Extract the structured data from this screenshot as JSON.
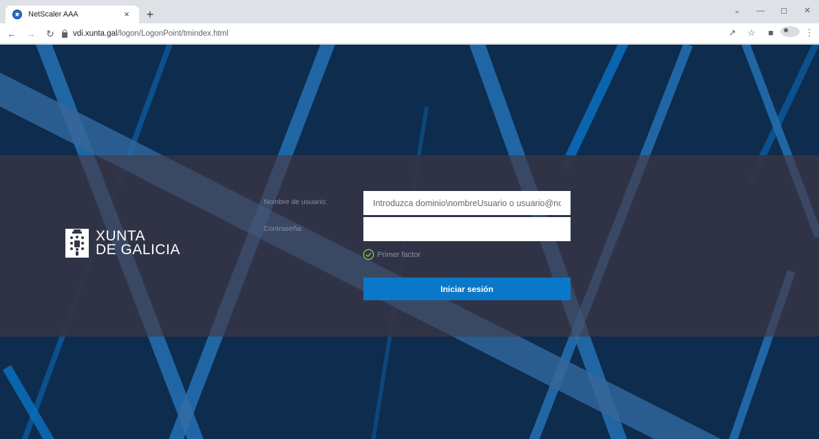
{
  "browser": {
    "tab_title": "NetScaler AAA",
    "tab_close": "×",
    "new_tab": "+",
    "url_host": "vdi.xunta.gal",
    "url_path": "/logon/LogonPoint/tmindex.html",
    "icons": [
      "back-icon",
      "forward-icon",
      "reload-icon",
      "lock-icon",
      "share-icon",
      "star-icon",
      "side-panel-icon",
      "profile-icon",
      "menu-icon"
    ]
  },
  "logo": {
    "line1": "XUNTA",
    "line2": "DE GALICIA"
  },
  "form": {
    "username_label": "Nombre de usuario:",
    "username_placeholder": "Introduzca dominio\\nombreUsuario o usuario@nombre",
    "password_label": "Contraseña:",
    "password_value": "",
    "factor_text": "Primer factor",
    "submit_label": "Iniciar sesión"
  },
  "colors": {
    "page_bg": "#0d2c4e",
    "band": "#343446",
    "button": "#0a78c8",
    "check": "#8bc34a"
  }
}
